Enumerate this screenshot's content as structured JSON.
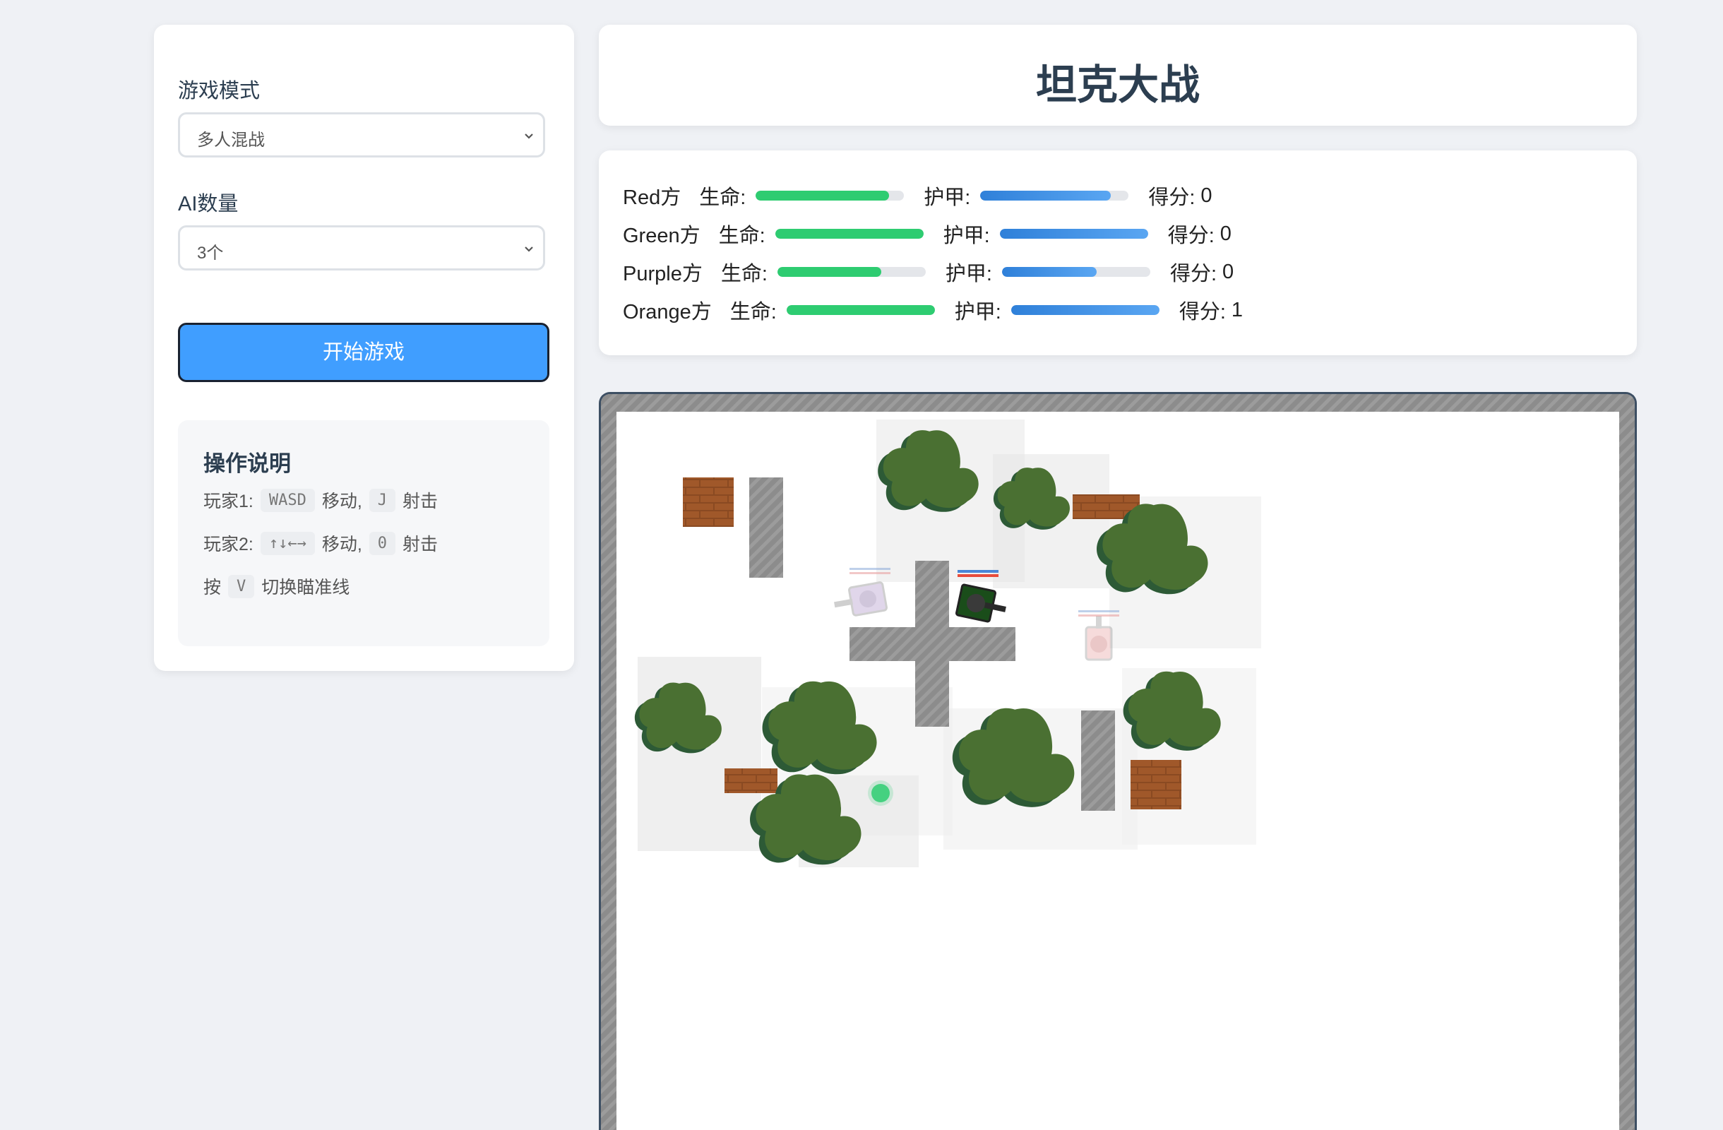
{
  "sidebar": {
    "mode_label": "游戏模式",
    "mode_value": "多人混战",
    "ai_label": "AI数量",
    "ai_value": "3个",
    "start_button": "开始游戏",
    "help": {
      "title": "操作说明",
      "p1_label": "玩家1:",
      "p1_move_key": "WASD",
      "move_text": "移动,",
      "p1_fire_key": "J",
      "fire_text": "射击",
      "p2_label": "玩家2:",
      "p2_move_key": "↑↓←→",
      "p2_fire_key": "0",
      "toggle_prefix": "按",
      "toggle_key": "V",
      "toggle_text": "切换瞄准线"
    }
  },
  "header": {
    "title": "坦克大战"
  },
  "labels": {
    "health": "生命:",
    "armor": "护甲:",
    "score": "得分:"
  },
  "players": [
    {
      "name": "Red方",
      "health": 0.9,
      "armor": 0.88,
      "score": "0"
    },
    {
      "name": "Green方",
      "health": 1.0,
      "armor": 1.0,
      "score": "0"
    },
    {
      "name": "Purple方",
      "health": 0.7,
      "armor": 0.64,
      "score": "0"
    },
    {
      "name": "Orange方",
      "health": 1.0,
      "armor": 1.0,
      "score": "1"
    }
  ],
  "colors": {
    "accent": "#409eff",
    "health": "#2ecc71",
    "armor": "#3a8ee6",
    "tree": "#4a7032",
    "brick": "#8a4a22",
    "steel": "#8e8e8e"
  }
}
